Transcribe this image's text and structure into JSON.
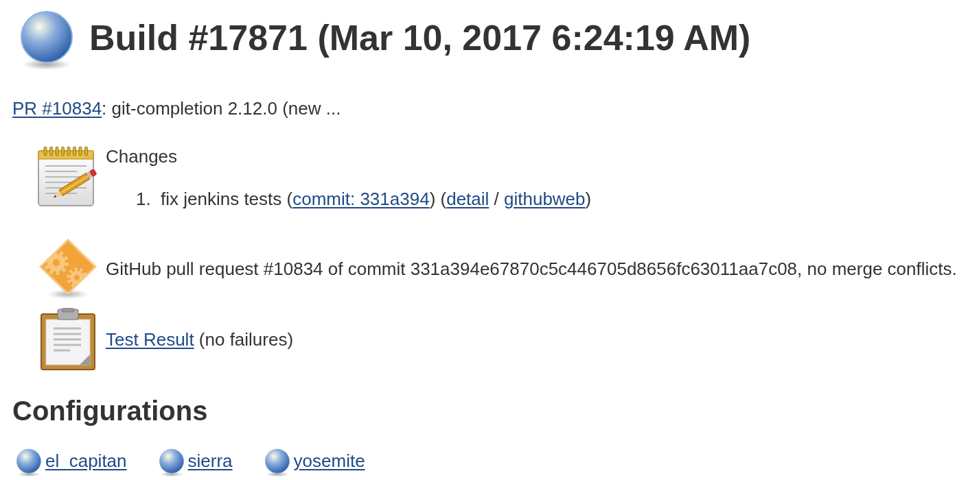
{
  "build": {
    "passed": true,
    "title": "Build #17871 (Mar 10, 2017 6:24:19 AM)"
  },
  "description": [
    {
      "kind": "link",
      "text": "PR #10834"
    },
    {
      "kind": "text",
      "text": ": git-completion 2.12.0 (new ..."
    }
  ],
  "summary": [
    {
      "kind": "changes",
      "heading": "Changes",
      "entries": [
        {
          "number": "1.",
          "parts": [
            {
              "kind": "text",
              "text": "fix jenkins tests ("
            },
            {
              "kind": "link",
              "text": "commit: 331a394"
            },
            {
              "kind": "text",
              "text": ") ("
            },
            {
              "kind": "link",
              "text": "detail"
            },
            {
              "kind": "text",
              "text": " / "
            },
            {
              "kind": "link",
              "text": "githubweb"
            },
            {
              "kind": "text",
              "text": ")"
            }
          ]
        }
      ]
    },
    {
      "kind": "pull_request",
      "parts": [
        {
          "kind": "text",
          "text": "GitHub pull request #10834 of commit 331a394e67870c5c446705d8656fc63011aa7c08, no merge conflicts."
        }
      ]
    },
    {
      "kind": "test_result",
      "parts": [
        {
          "kind": "link",
          "text": "Test Result"
        },
        {
          "kind": "text",
          "text": " (no failures)"
        }
      ]
    }
  ],
  "configurations": {
    "heading": "Configurations",
    "items": [
      {
        "name": "el_capitan",
        "passed": true
      },
      {
        "name": "sierra",
        "passed": true
      },
      {
        "name": "yosemite",
        "passed": true
      }
    ]
  }
}
